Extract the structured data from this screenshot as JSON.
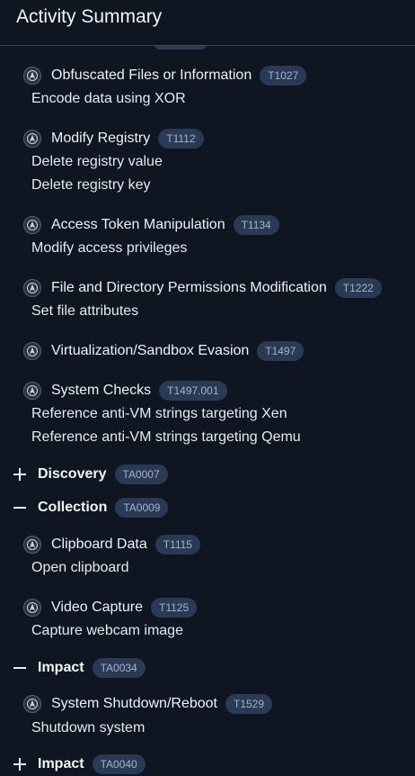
{
  "header": {
    "title": "Activity Summary"
  },
  "techniques": [
    {
      "name": "Obfuscated Files or Information",
      "id": "T1027",
      "descriptions": [
        "Encode data using XOR"
      ]
    },
    {
      "name": "Modify Registry",
      "id": "T1112",
      "descriptions": [
        "Delete registry value",
        "Delete registry key"
      ]
    },
    {
      "name": "Access Token Manipulation",
      "id": "T1134",
      "descriptions": [
        "Modify access privileges"
      ]
    },
    {
      "name": "File and Directory Permissions Modification",
      "id": "T1222",
      "descriptions": [
        "Set file attributes"
      ]
    },
    {
      "name": "Virtualization/Sandbox Evasion",
      "id": "T1497",
      "descriptions": []
    },
    {
      "name": "System Checks",
      "id": "T1497.001",
      "descriptions": [
        "Reference anti-VM strings targeting Xen",
        "Reference anti-VM strings targeting Qemu"
      ]
    },
    {
      "name": "Clipboard Data",
      "id": "T1115",
      "descriptions": [
        "Open clipboard"
      ]
    },
    {
      "name": "Video Capture",
      "id": "T1125",
      "descriptions": [
        "Capture webcam image"
      ]
    },
    {
      "name": "System Shutdown/Reboot",
      "id": "T1529",
      "descriptions": [
        "Shutdown system"
      ]
    }
  ],
  "tactics": [
    {
      "name": "Discovery",
      "id": "TA0007",
      "expanded": false
    },
    {
      "name": "Collection",
      "id": "TA0009",
      "expanded": true
    },
    {
      "name": "Impact",
      "id": "TA0034",
      "expanded": true
    },
    {
      "name": "Impact",
      "id": "TA0040",
      "expanded": false
    }
  ],
  "icons": {
    "technique": "attack-emblem-icon",
    "expand": "plus-icon",
    "collapse": "minus-icon"
  }
}
